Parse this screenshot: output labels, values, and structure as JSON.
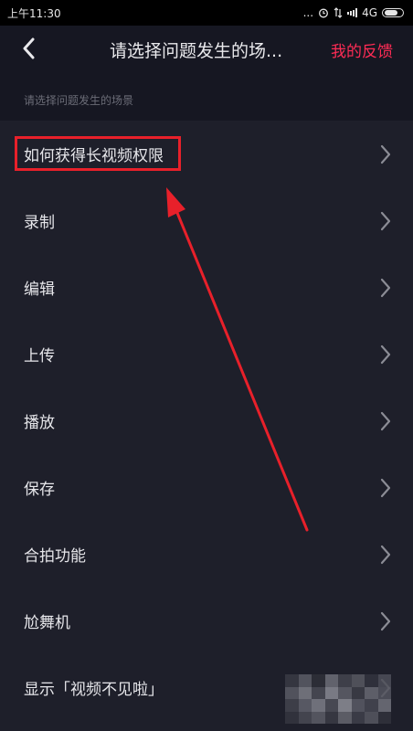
{
  "status_bar": {
    "time": "上午11:30",
    "dots": "...",
    "network": "4G"
  },
  "header": {
    "title": "请选择问题发生的场...",
    "feedback_link": "我的反馈"
  },
  "section": {
    "label": "请选择问题发生的场景"
  },
  "items": [
    {
      "label": "如何获得长视频权限",
      "highlighted": true
    },
    {
      "label": "录制"
    },
    {
      "label": "编辑"
    },
    {
      "label": "上传"
    },
    {
      "label": "播放"
    },
    {
      "label": "保存"
    },
    {
      "label": "合拍功能"
    },
    {
      "label": "尬舞机"
    },
    {
      "label": "显示「视频不见啦」"
    }
  ],
  "colors": {
    "accent": "#fe2c55",
    "annotation": "#e8202a",
    "background": "#1e1f2a",
    "header_background": "#161722"
  },
  "icons": {
    "back": "chevron-left-icon",
    "row": "chevron-right-icon",
    "alarm": "alarm-icon",
    "signal": "signal-icon",
    "battery": "battery-icon"
  }
}
